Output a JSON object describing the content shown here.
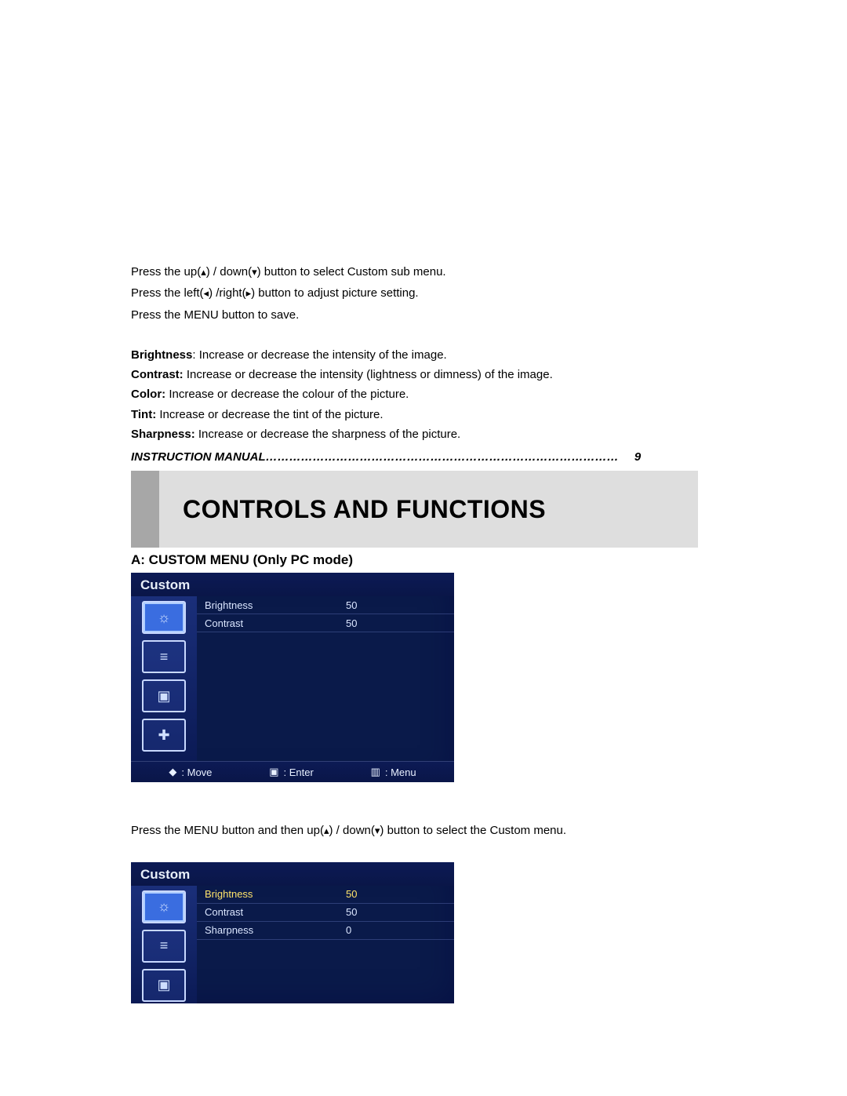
{
  "instructions": {
    "line1_pre": "Press the up(",
    "line1_mid": ") / down(",
    "line1_post": ") button to select Custom sub menu.",
    "line2_pre": "Press the left(",
    "line2_mid": ") /right(",
    "line2_post": ") button to adjust picture setting.",
    "line3": "Press the MENU button to save."
  },
  "definitions": {
    "brightness_label": "Brightness",
    "brightness_text": ": Increase or decrease the intensity of the image.",
    "contrast_label": "Contrast:",
    "contrast_text": " Increase or decrease the intensity (lightness or dimness) of the image.",
    "color_label": "Color:",
    "color_text": " Increase or decrease the colour of the picture.",
    "tint_label": "Tint:",
    "tint_text": " Increase or decrease the tint of the picture.",
    "sharpness_label": "Sharpness:",
    "sharpness_text": " Increase or decrease the sharpness of the picture."
  },
  "footer": {
    "label": "INSTRUCTION MANUAL………………………………………………………………………………",
    "page": "9"
  },
  "section_header": "CONTROLS AND FUNCTIONS",
  "subhead": "A: CUSTOM MENU (Only PC mode)",
  "osd1": {
    "title": "Custom",
    "rows": [
      {
        "label": "Brightness",
        "value": "50"
      },
      {
        "label": "Contrast",
        "value": "50"
      }
    ],
    "footer": {
      "move": ": Move",
      "enter": ": Enter",
      "menu": ": Menu"
    }
  },
  "between_text_pre": "Press the MENU button and then up(",
  "between_text_mid": ") / down(",
  "between_text_post": ") button to select the Custom menu.",
  "osd2": {
    "title": "Custom",
    "rows": [
      {
        "label": "Brightness",
        "value": "50",
        "sel": true
      },
      {
        "label": "Contrast",
        "value": "50"
      },
      {
        "label": "Sharpness",
        "value": "0"
      }
    ]
  },
  "icons": {
    "up": "▴",
    "down": "▾",
    "left": "◂",
    "right": "▸",
    "updown": "◆",
    "enter_square": "▣",
    "menu_bars": "▥",
    "picture": "☼",
    "video": "≡",
    "pip": "▣",
    "tools": "✚"
  }
}
